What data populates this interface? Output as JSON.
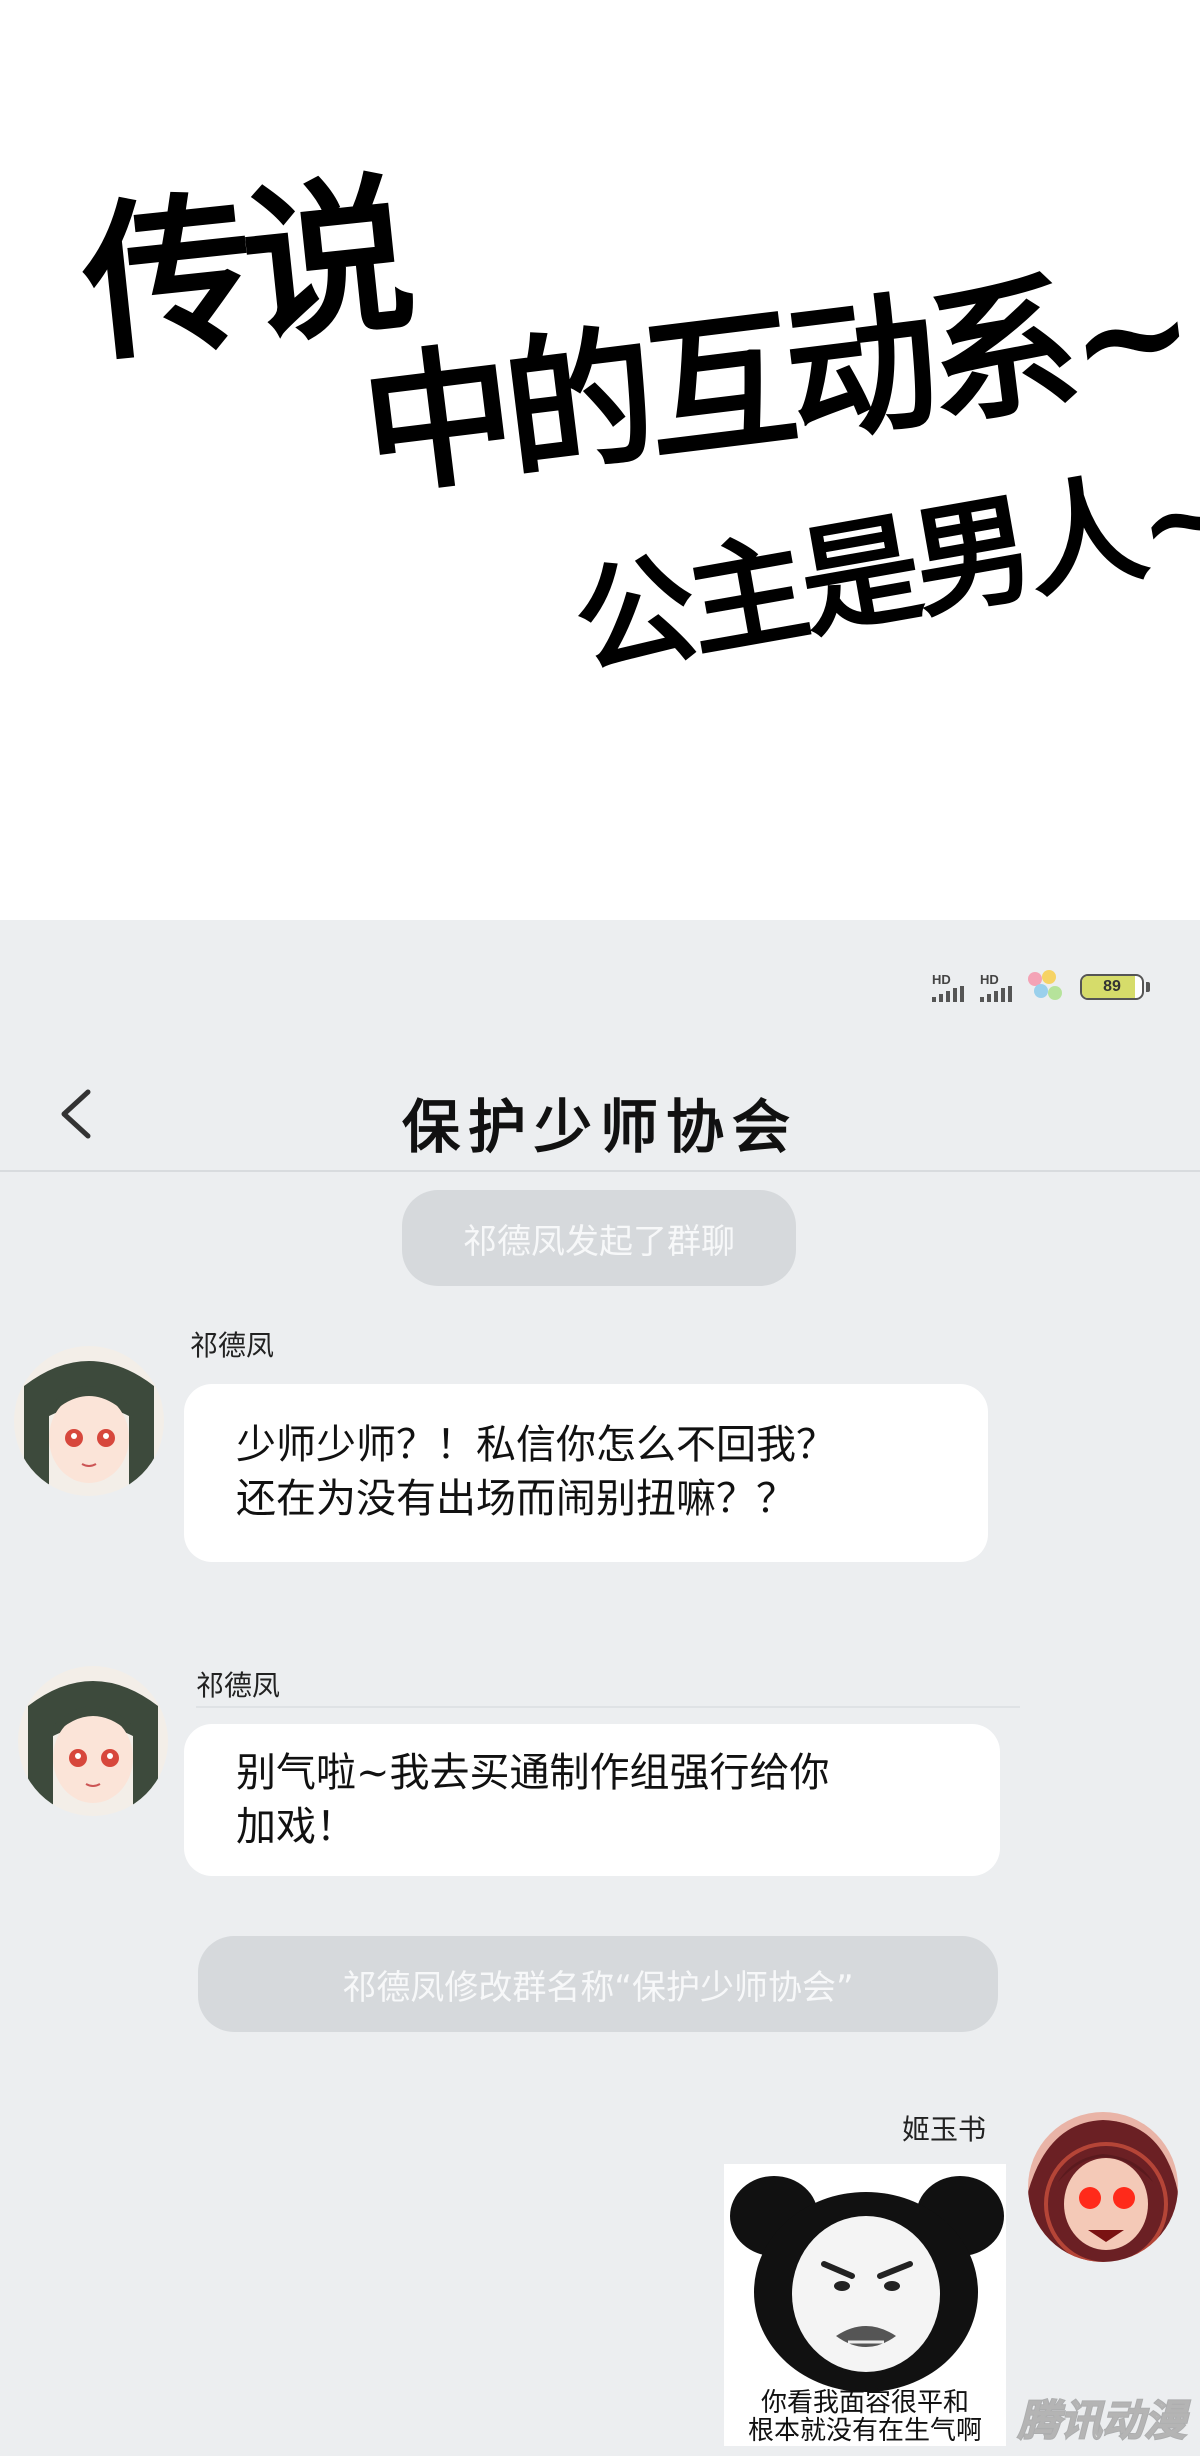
{
  "header": {
    "title_line1": "传说",
    "title_line2": "中的互动系~",
    "title_line3": "公主是男人~~"
  },
  "status_bar": {
    "signal1_label": "HD",
    "signal2_label": "HD",
    "battery_level": 89,
    "battery_text": "89"
  },
  "nav": {
    "title": "保护少师协会",
    "back_icon": "chevron-left-icon"
  },
  "messages": {
    "system1": "祁德凤发起了群聊",
    "msg1": {
      "sender": "祁德凤",
      "line1": "少师少师？！私信你怎么不回我？",
      "line2": "还在为没有出场而闹别扭嘛？？"
    },
    "msg2": {
      "sender": "祁德凤",
      "line1": "别气啦~我去买通制作组强行给你",
      "line2": "加戏！"
    },
    "system2": "祁德凤修改群名称“保护少师协会”",
    "msg3": {
      "sender": "姬玉书",
      "caption1": "你看我面容很平和",
      "caption2": "根本就没有在生气啊"
    }
  },
  "watermark": "腾讯动漫",
  "colors": {
    "screen_bg": "#eceef0",
    "bubble_bg": "#ffffff",
    "system_pill_bg": "#d6d9dc",
    "system_pill_text": "#f7f8f9",
    "battery_fill": "#d6dc6a"
  }
}
